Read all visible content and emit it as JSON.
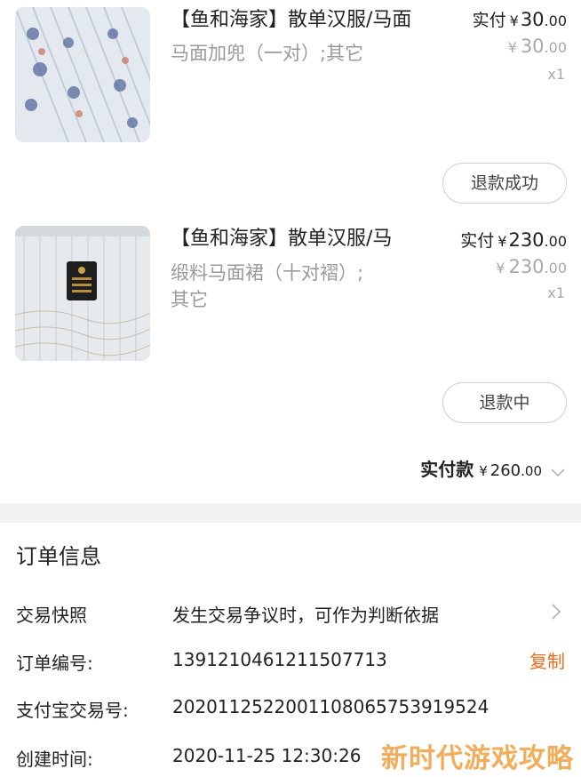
{
  "items": [
    {
      "title": "【鱼和海家】散单汉服/马面",
      "spec_line1": "马面加兜（一对）;其它",
      "spec_line2": "",
      "paid_label": "实付",
      "paid_yen": "¥",
      "paid_int": "30",
      "paid_dec": ".00",
      "orig_yen": "¥",
      "orig_int": "30",
      "orig_dec": ".00",
      "qty": "x1",
      "status": "退款成功"
    },
    {
      "title": "【鱼和海家】散单汉服/马",
      "spec_line1": "缎料马面裙（十对褶）;",
      "spec_line2": "其它",
      "paid_label": "实付",
      "paid_yen": "¥",
      "paid_int": "230",
      "paid_dec": ".00",
      "orig_yen": "¥",
      "orig_int": "230",
      "orig_dec": ".00",
      "qty": "x1",
      "status": "退款中"
    }
  ],
  "total": {
    "label": "实付款",
    "yen": "¥",
    "int": "260",
    "dec": ".00"
  },
  "order_info": {
    "title": "订单信息",
    "rows": [
      {
        "label": "交易快照",
        "value": "发生交易争议时，可作为判断依据"
      },
      {
        "label": "订单编号:",
        "value": "1391210461211507713",
        "action": "复制"
      },
      {
        "label": "支付宝交易号:",
        "value": "2020112522001108065753919524"
      },
      {
        "label": "创建时间:",
        "value": "2020-11-25 12:30:26"
      }
    ]
  },
  "watermark": "新时代游戏攻略",
  "colors": {
    "accent": "#f06a1a",
    "muted": "#9a9a9a",
    "divider": "#f2f2f2"
  }
}
